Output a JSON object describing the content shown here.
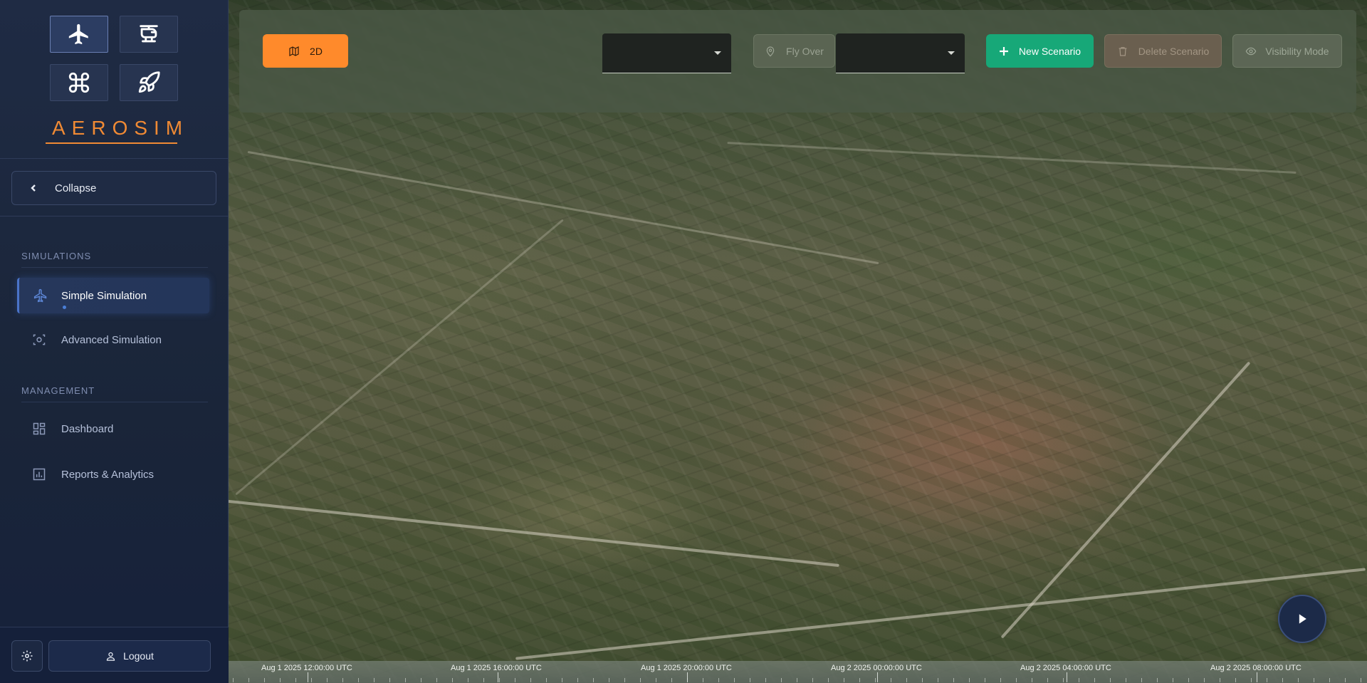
{
  "app": {
    "brand": "AEROSIM"
  },
  "mode_switcher": [
    {
      "icon": "airplane-icon",
      "active": true
    },
    {
      "icon": "helicopter-icon",
      "active": false
    },
    {
      "icon": "drone-icon",
      "active": false
    },
    {
      "icon": "rocket-icon",
      "active": false
    }
  ],
  "sidebar": {
    "collapse_label": "Collapse",
    "sections": [
      {
        "title": "SIMULATIONS",
        "items": [
          {
            "label": "Simple Simulation",
            "icon": "airplane-icon",
            "active": true
          },
          {
            "label": "Advanced Simulation",
            "icon": "scan-icon",
            "active": false
          }
        ]
      },
      {
        "title": "MANAGEMENT",
        "items": [
          {
            "label": "Dashboard",
            "icon": "dashboard-grid-icon",
            "active": false
          },
          {
            "label": "Reports & Analytics",
            "icon": "bar-chart-icon",
            "active": false
          }
        ]
      }
    ],
    "footer": {
      "settings_icon": "gear-icon",
      "logout_label": "Logout",
      "logout_icon": "user-icon"
    }
  },
  "toolbar": {
    "view_toggle_label": "2D",
    "view_toggle_icon": "map-icon",
    "select_1_value": "",
    "fly_over_label": "Fly Over",
    "fly_over_icon": "map-pin-icon",
    "select_2_value": "",
    "new_scenario_label": "New Scenario",
    "delete_scenario_label": "Delete Scenario",
    "visibility_mode_label": "Visibility Mode"
  },
  "colors": {
    "accent_orange": "#ff8a2b",
    "new_scenario_green": "#17a878",
    "sidebar_bg": "#1f2b44",
    "brand_color": "#f08a34"
  },
  "timeline": {
    "labels": [
      "Aug 1 2025 12:00:00 UTC",
      "Aug 1 2025 16:00:00 UTC",
      "Aug 1 2025 20:00:00 UTC",
      "Aug 2 2025 00:00:00 UTC",
      "Aug 2 2025 04:00:00 UTC",
      "Aug 2 2025 08:00:00 UTC"
    ]
  },
  "player": {
    "play_icon": "play-icon"
  }
}
